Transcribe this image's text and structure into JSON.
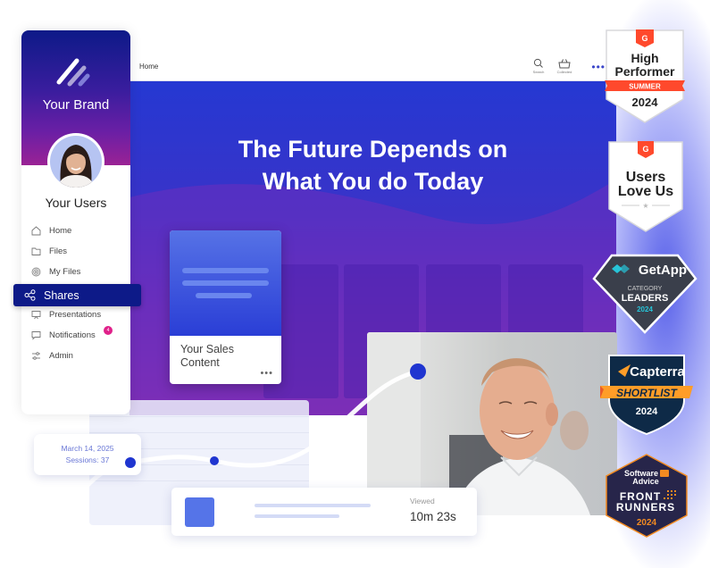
{
  "sidebar": {
    "brand": "Your Brand",
    "user_label": "Your Users",
    "items": [
      {
        "label": "Home",
        "icon": "home-icon"
      },
      {
        "label": "Files",
        "icon": "folder-icon"
      },
      {
        "label": "My Files",
        "icon": "fingerprint-icon"
      },
      {
        "label": "Shares",
        "icon": "share-icon",
        "active": true
      },
      {
        "label": "Presentations",
        "icon": "presentation-icon"
      },
      {
        "label": "Notifications",
        "icon": "chat-icon",
        "badge": "4"
      },
      {
        "label": "Admin",
        "icon": "sliders-icon"
      }
    ]
  },
  "header": {
    "breadcrumb": "Home",
    "search_label": "Search",
    "collected_label": "Collected",
    "more": "•••"
  },
  "hero": {
    "title_line1": "The Future Depends on",
    "title_line2": "What You do Today"
  },
  "content_card": {
    "title_line1": "Your Sales",
    "title_line2": "Content",
    "more": "•••"
  },
  "tooltip": {
    "date": "March 14, 2025",
    "sessions": "Sessions: 37"
  },
  "viewed": {
    "label": "Viewed",
    "value": "10m 23s"
  },
  "awards": [
    {
      "brand": "G2",
      "line1": "High",
      "line2": "Performer",
      "ribbon": "SUMMER",
      "year": "2024"
    },
    {
      "brand": "G2",
      "line1": "Users",
      "line2": "Love Us"
    },
    {
      "brand": "GetApp",
      "line1": "CATEGORY",
      "line2": "LEADERS",
      "year": "2024"
    },
    {
      "brand": "Capterra",
      "ribbon": "SHORTLIST",
      "year": "2024"
    },
    {
      "brand_line1": "Software",
      "brand_line2": "Advice",
      "line1": "FRONT",
      "line2": "RUNNERS",
      "year": "2024"
    }
  ],
  "colors": {
    "brand_navy": "#0d1a88",
    "hero_blue": "#2538d2",
    "accent_dot": "#1f35d0",
    "badge_pink": "#e0218a",
    "g2_red": "#ff492c"
  }
}
